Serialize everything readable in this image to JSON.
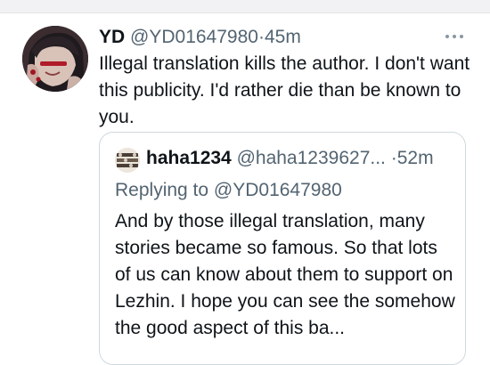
{
  "tweet": {
    "display_name": "YD",
    "handle": "@YD01647980",
    "separator": "·",
    "time": "45m",
    "text": "Illegal translation kills the author. I don't want this publicity. I'd rather die than be known to you.",
    "more_icon": "more-dots-icon"
  },
  "quoted_tweet": {
    "display_name": "haha1234",
    "handle": "@haha1239627...",
    "separator": "·",
    "time": "52m",
    "replying_prefix": "Replying to ",
    "replying_to": "@YD01647980",
    "text": "And by those illegal translation, many stories became so famous. So that lots of us can know about them to support on Lezhin. I hope you can see the somehow the good aspect of this ba..."
  },
  "colors": {
    "text": "#0f1419",
    "secondary": "#536471",
    "border": "#cfd9de"
  }
}
